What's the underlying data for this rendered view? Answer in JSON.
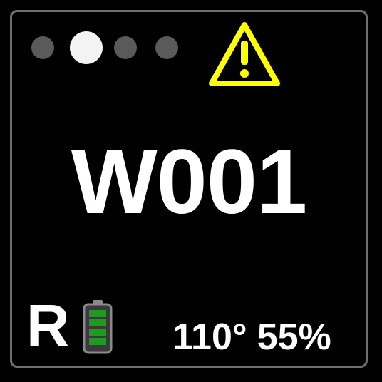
{
  "pagination": {
    "total_pages": 4,
    "active_index": 1,
    "active_color": "#f3f3f3",
    "inactive_color": "#5a5a5a"
  },
  "status": {
    "warning_icon": "warning-triangle-icon",
    "warning_color": "#ffff00",
    "code": "W001"
  },
  "footer": {
    "mode": "R",
    "battery_icon": "battery-full-icon",
    "battery_level_percent": 100,
    "battery_color": "#1f9b1f",
    "temperature": "110°",
    "humidity": "55%"
  }
}
